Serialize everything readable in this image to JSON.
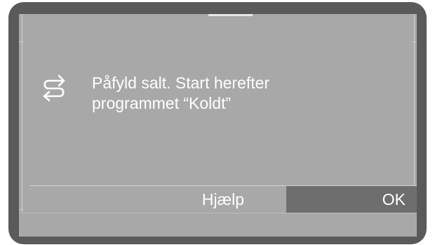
{
  "dialog": {
    "icon": "refill-arrows-icon",
    "message_line1": "Påfyld salt. Start herefter",
    "message_line2": "programmet “Koldt”"
  },
  "buttons": {
    "help_label": "Hjælp",
    "ok_label": "OK"
  },
  "colors": {
    "frame": "#5a5a5a",
    "screen": "#a8a8a8",
    "ok_button": "#6e6e6e",
    "text": "#ffffff"
  }
}
